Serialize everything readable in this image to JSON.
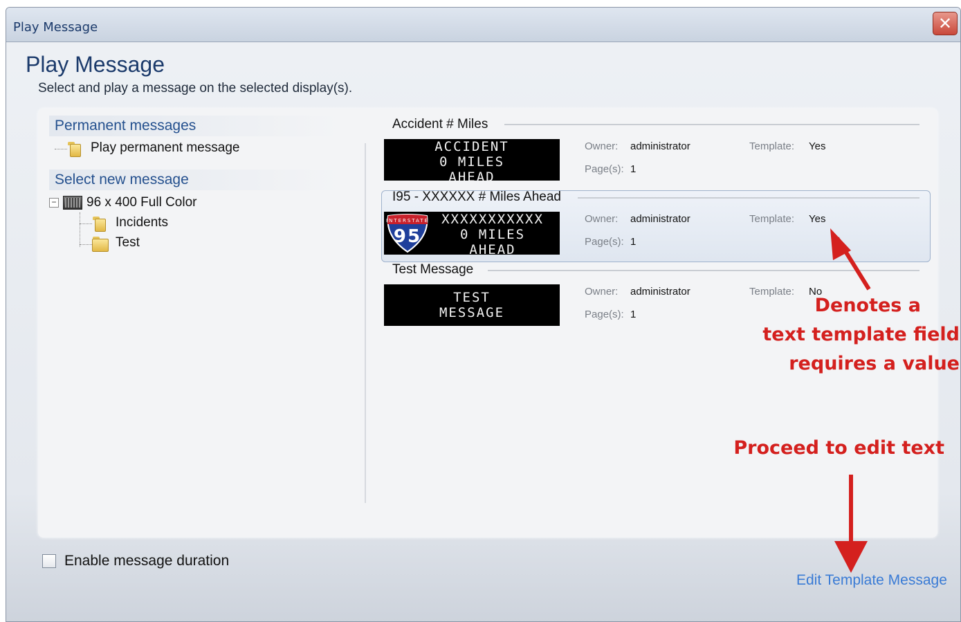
{
  "window": {
    "title": "Play Message",
    "close_glyph": "✕"
  },
  "header": {
    "title": "Play Message",
    "subtitle": "Select and play a message on the selected display(s)."
  },
  "left": {
    "permanent_header": "Permanent messages",
    "permanent_item": "Play permanent message",
    "select_header": "Select new message",
    "tree_root": "96 x 400 Full Color",
    "tree_children": [
      "Incidents",
      "Test"
    ]
  },
  "messages": [
    {
      "title": "Accident # Miles",
      "led_lines": [
        "ACCIDENT",
        "0 MILES",
        "AHEAD"
      ],
      "owner_label": "Owner:",
      "owner": "administrator",
      "pages_label": "Page(s):",
      "pages": "1",
      "template_label": "Template:",
      "template": "Yes"
    },
    {
      "title": "I95 - XXXXXX # Miles Ahead",
      "led_lines": [
        "XXXXXXXXXXX",
        "0 MILES",
        "AHEAD"
      ],
      "shield_label": "INTERSTATE",
      "shield_number": "95",
      "owner_label": "Owner:",
      "owner": "administrator",
      "pages_label": "Page(s):",
      "pages": "1",
      "template_label": "Template:",
      "template": "Yes"
    },
    {
      "title": "Test Message",
      "led_lines": [
        "TEST",
        "MESSAGE"
      ],
      "owner_label": "Owner:",
      "owner": "administrator",
      "pages_label": "Page(s):",
      "pages": "1",
      "template_label": "Template:",
      "template": "No"
    }
  ],
  "annotations": {
    "template_note": [
      "Denotes a",
      "text template field",
      "requires a value"
    ],
    "proceed_note": "Proceed to edit text"
  },
  "footer": {
    "enable_duration_label": "Enable message duration",
    "edit_template_link": "Edit Template Message"
  },
  "colors": {
    "annotation": "#d4201e",
    "link": "#3a7bd5",
    "heading": "#1b3a6b"
  }
}
